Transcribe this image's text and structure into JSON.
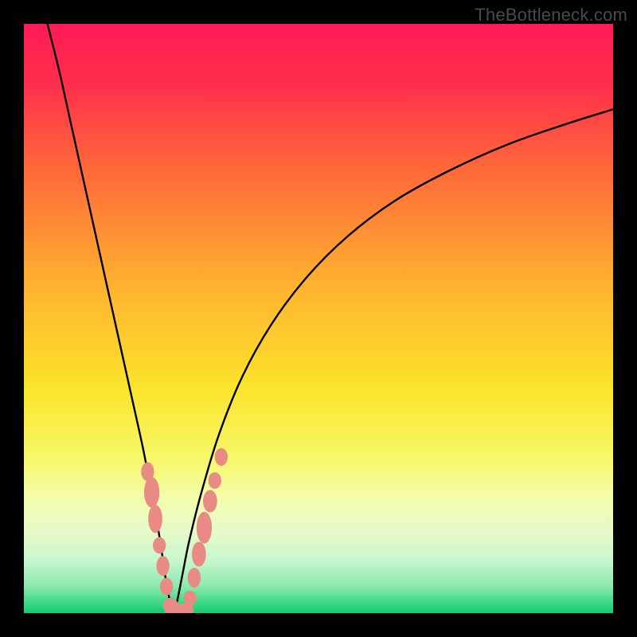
{
  "watermark": {
    "text": "TheBottleneck.com"
  },
  "gradient": {
    "stops": [
      {
        "offset": 0.0,
        "color": "#ff1b56"
      },
      {
        "offset": 0.1,
        "color": "#ff2e4c"
      },
      {
        "offset": 0.25,
        "color": "#ff6a3a"
      },
      {
        "offset": 0.45,
        "color": "#ffb42f"
      },
      {
        "offset": 0.62,
        "color": "#fbe42c"
      },
      {
        "offset": 0.74,
        "color": "#f7f86a"
      },
      {
        "offset": 0.8,
        "color": "#f3fca8"
      },
      {
        "offset": 0.86,
        "color": "#e7fbc9"
      },
      {
        "offset": 0.91,
        "color": "#c9f6cf"
      },
      {
        "offset": 0.955,
        "color": "#8be9ac"
      },
      {
        "offset": 0.985,
        "color": "#34d884"
      },
      {
        "offset": 1.0,
        "color": "#17c96f"
      }
    ]
  },
  "chart_data": {
    "type": "line",
    "title": "",
    "xlabel": "",
    "ylabel": "",
    "xlim": [
      0,
      100
    ],
    "ylim": [
      0,
      100
    ],
    "grid": false,
    "series": [
      {
        "name": "left-branch",
        "x": [
          4,
          6,
          8,
          10,
          12,
          14,
          16,
          18,
          20,
          21,
          22,
          23,
          23.6,
          24.2,
          24.8,
          25.4
        ],
        "y": [
          100,
          92,
          83,
          74,
          65,
          56,
          47,
          38,
          29,
          24,
          19,
          13,
          9,
          5,
          2,
          0
        ]
      },
      {
        "name": "right-branch",
        "x": [
          25.4,
          26,
          27,
          28,
          30,
          33,
          37,
          42,
          48,
          55,
          63,
          72,
          82,
          92,
          100
        ],
        "y": [
          0,
          2,
          7,
          12,
          20,
          30,
          40,
          49,
          57,
          64,
          70,
          75,
          79.5,
          83,
          85.5
        ]
      }
    ],
    "markers": {
      "name": "highlighted-points",
      "color": "#e98b85",
      "points": [
        {
          "x": 21.0,
          "y": 24.0,
          "rx": 1.1,
          "ry": 1.6
        },
        {
          "x": 21.7,
          "y": 20.5,
          "rx": 1.3,
          "ry": 2.6
        },
        {
          "x": 22.3,
          "y": 16.0,
          "rx": 1.2,
          "ry": 2.4
        },
        {
          "x": 23.0,
          "y": 11.5,
          "rx": 1.1,
          "ry": 1.4
        },
        {
          "x": 23.6,
          "y": 8.0,
          "rx": 1.1,
          "ry": 1.7
        },
        {
          "x": 24.2,
          "y": 4.5,
          "rx": 1.1,
          "ry": 1.5
        },
        {
          "x": 24.9,
          "y": 1.3,
          "rx": 1.3,
          "ry": 1.3
        },
        {
          "x": 25.4,
          "y": 0.4,
          "rx": 1.5,
          "ry": 1.2
        },
        {
          "x": 26.3,
          "y": 0.4,
          "rx": 1.5,
          "ry": 1.2
        },
        {
          "x": 27.3,
          "y": 0.5,
          "rx": 1.5,
          "ry": 1.2
        },
        {
          "x": 28.2,
          "y": 2.5,
          "rx": 1.1,
          "ry": 1.3
        },
        {
          "x": 28.9,
          "y": 6.0,
          "rx": 1.1,
          "ry": 1.7
        },
        {
          "x": 29.7,
          "y": 10.0,
          "rx": 1.2,
          "ry": 2.1
        },
        {
          "x": 30.6,
          "y": 14.5,
          "rx": 1.3,
          "ry": 2.7
        },
        {
          "x": 31.6,
          "y": 19.0,
          "rx": 1.2,
          "ry": 1.9
        },
        {
          "x": 32.4,
          "y": 22.5,
          "rx": 1.1,
          "ry": 1.4
        },
        {
          "x": 33.5,
          "y": 26.5,
          "rx": 1.1,
          "ry": 1.5
        }
      ]
    }
  }
}
